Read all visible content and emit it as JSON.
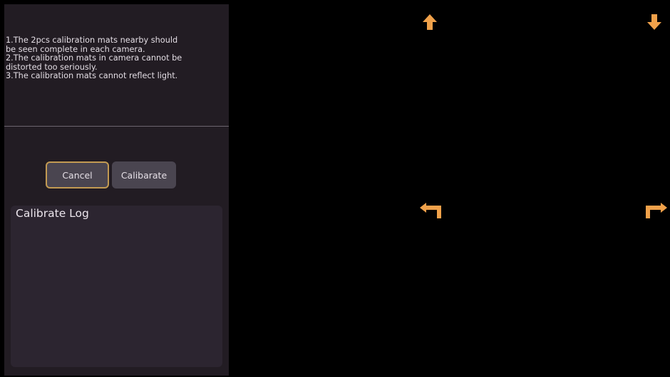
{
  "instructions": [
    "1.The 2pcs calibration mats nearby should",
    "be seen complete in each camera.",
    "2.The calibration mats in camera cannot be",
    "distorted too seriously.",
    "3.The calibration mats cannot reflect light."
  ],
  "buttons": {
    "cancel_label": "Cancel",
    "calibrate_label": "Calibarate"
  },
  "log": {
    "title": "Calibrate Log"
  },
  "icons": {
    "arrow_up": "arrow-up-icon",
    "arrow_down": "arrow-down-icon",
    "turn_left": "turn-left-icon",
    "turn_right": "turn-right-icon"
  },
  "colors": {
    "panel_bg": "#221c23",
    "button_bg": "#4a4550",
    "focus_border": "#c29a52",
    "log_bg": "#2c2530",
    "arrow_color": "#f0a14a",
    "text": "#e3dde4"
  }
}
